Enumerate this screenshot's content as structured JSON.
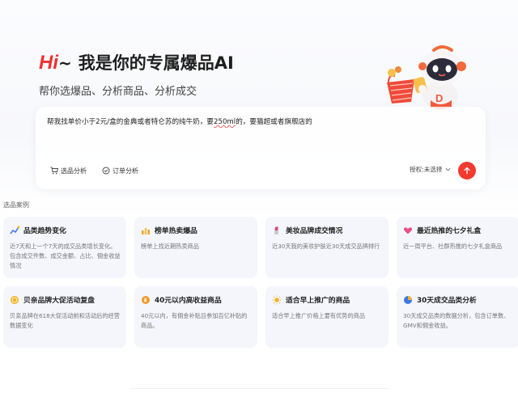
{
  "hero": {
    "hi": "Hi",
    "tilde": "~",
    "title": "我是你的专属爆品AI",
    "subtitle": "帮你选爆品、分析商品、分析成交"
  },
  "query": {
    "text_before": "帮我找单价小于2元/盒的金典或者特仑苏的纯牛奶，要",
    "text_underlined": "250ml",
    "text_after": "的，要猫超或者旗舰店的",
    "tool_product": "选品分析",
    "tool_order": "订单分析",
    "auth_label": "授权:未选择",
    "send_icon": "arrow-up-icon"
  },
  "section_label": "选品案例",
  "cards": [
    {
      "title": "品类趋势变化",
      "desc": "近7天和上一个7天的成交品类增长变化。包含成交件数、成交金额、占比、佣金收益情况",
      "icon": "trend-icon",
      "color": "#4a7cf0"
    },
    {
      "title": "榜单热卖爆品",
      "desc": "榜单上找近期热卖商品",
      "icon": "bar-chart-icon",
      "color": "#f0a030"
    },
    {
      "title": "美妆品牌成交情况",
      "desc": "近30天我的美妆护肤近30天成交品牌排行",
      "icon": "lipstick-icon",
      "color": "#e0457a"
    },
    {
      "title": "最近热推的七夕礼盒",
      "desc": "近一周平台、社群热推的七夕礼盒商品",
      "icon": "heart-icon",
      "color": "#e8508a"
    },
    {
      "title": "贝亲品牌大促活动复盘",
      "desc": "贝亲品牌在618大促活动前和活动后的经营数据变化",
      "icon": "coin-icon",
      "color": "#f3b52a"
    },
    {
      "title": "40元以内高收益商品",
      "desc": "40元以内，有佣金补贴且参加百亿补贴的商品。",
      "icon": "money-icon",
      "color": "#f09a30"
    },
    {
      "title": "适合早上推广的商品",
      "desc": "适合早上推广价格上要有优势的商品",
      "icon": "sun-icon",
      "color": "#f2b22a"
    },
    {
      "title": "30天成交品类分析",
      "desc": "30天成交品类的数据分析，包含订单数、GMV和佣金收益。",
      "icon": "pie-icon",
      "color": "#3b78e8"
    }
  ]
}
